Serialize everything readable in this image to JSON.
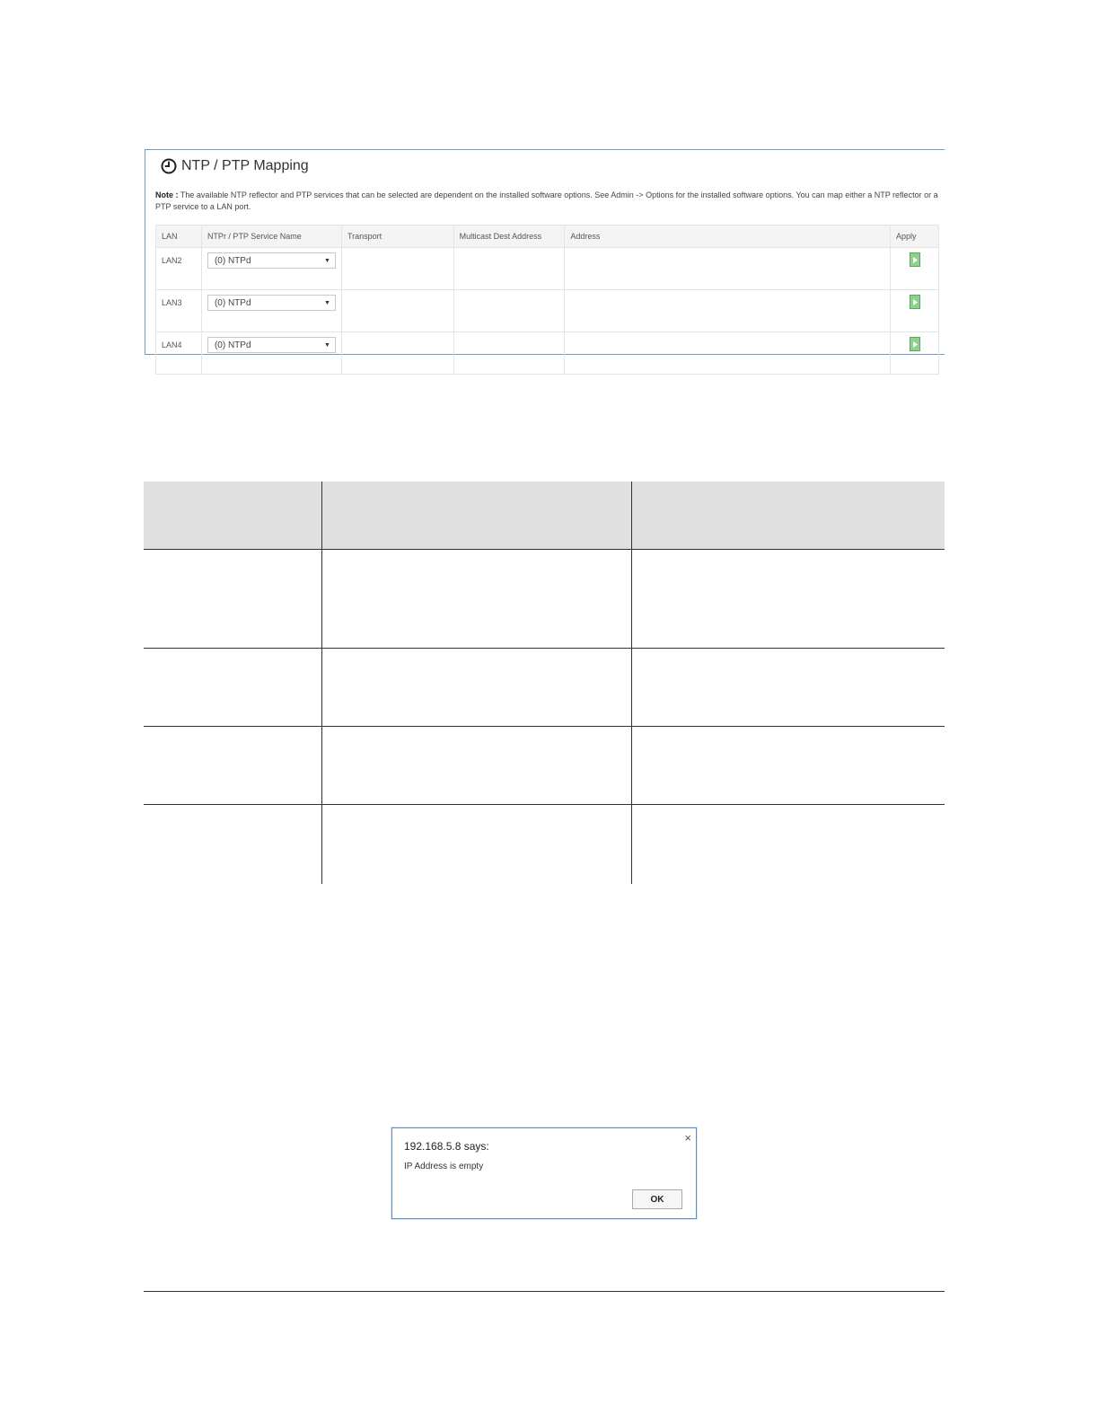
{
  "panel": {
    "title": "NTP / PTP Mapping",
    "note_label": "Note :",
    "note_text": "The available NTP reflector and PTP services that can be selected are dependent on the installed software options. See Admin -> Options for the installed software options. You can map either a NTP reflector or a PTP service to a LAN port.",
    "columns": [
      "LAN",
      "NTPr / PTP Service Name",
      "Transport",
      "Multicast Dest Address",
      "Address",
      "Apply"
    ],
    "rows": [
      {
        "lan": "LAN2",
        "service": "(0) NTPd",
        "transport": "",
        "multicast": "",
        "address": ""
      },
      {
        "lan": "LAN3",
        "service": "(0) NTPd",
        "transport": "",
        "multicast": "",
        "address": ""
      },
      {
        "lan": "LAN4",
        "service": "(0) NTPd",
        "transport": "",
        "multicast": "",
        "address": ""
      }
    ],
    "icons": {
      "title": "clock-icon",
      "apply": "apply-arrow-icon",
      "dropdown": "chevron-down-icon"
    },
    "colors": {
      "border": "#6d9fc7",
      "apply_button": "#8fd08f",
      "header_bg": "#f4f4f4"
    }
  },
  "grid": {
    "header_bg": "#e0e0e0",
    "rows": [
      [
        "",
        "",
        ""
      ],
      [
        "",
        "",
        ""
      ],
      [
        "",
        "",
        ""
      ],
      [
        "",
        "",
        ""
      ]
    ]
  },
  "dialog": {
    "title": "192.168.5.8 says:",
    "message": "IP Address is empty",
    "ok_label": "OK",
    "close_glyph": "×"
  }
}
